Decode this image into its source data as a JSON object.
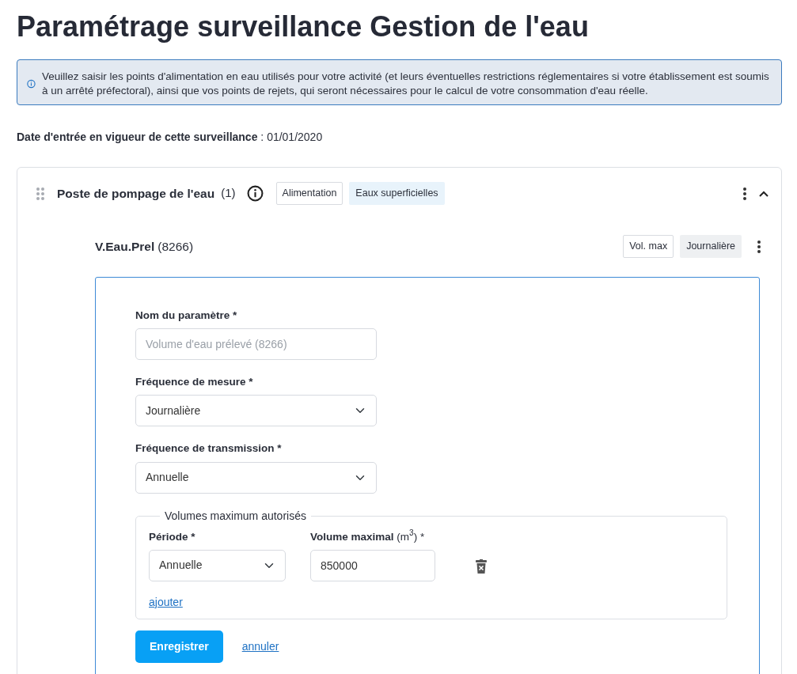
{
  "page": {
    "title": "Paramétrage surveillance Gestion de l'eau"
  },
  "info_alert": {
    "text": "Veuillez saisir les points d'alimentation en eau utilisés pour votre activité (et leurs éventuelles restrictions réglementaires si votre établissement est soumis à un arrêté préfectoral), ainsi que vos points de rejets, qui seront nécessaires pour le calcul de votre consommation d'eau réelle."
  },
  "effective_date": {
    "label": "Date d'entrée en vigueur de cette surveillance",
    "separator": " : ",
    "value": "01/01/2020"
  },
  "point": {
    "name": "Poste de pompage de l'eau",
    "count": "(1)",
    "expanded": true,
    "tags": [
      {
        "label": "Alimentation",
        "kind": "outline"
      },
      {
        "label": "Eaux superficielles",
        "kind": "tinted"
      }
    ],
    "parameter": {
      "code": "V.Eau.Prel",
      "number": "(8266)",
      "tags": [
        {
          "label": "Vol. max",
          "kind": "outline"
        },
        {
          "label": "Journalière",
          "kind": "grey"
        }
      ],
      "form": {
        "fields": [
          {
            "kind": "text",
            "label": "Nom du paramètre *",
            "placeholder": "Volume d'eau prélevé (8266)"
          },
          {
            "kind": "select",
            "label": "Fréquence de mesure *",
            "value": "Journalière"
          },
          {
            "kind": "select",
            "label": "Fréquence de transmission *",
            "value": "Annuelle"
          }
        ],
        "volumes": {
          "legend": "Volumes maximum autorisés",
          "period_label": "Période *",
          "volume_label": "**Volume maximal** (m$^{3}$) *",
          "rows": [
            {
              "period": "Annuelle",
              "volume": "850000"
            }
          ],
          "add_link": "ajouter"
        },
        "save_button": "Enregistrer",
        "cancel_link": "annuler"
      }
    }
  }
}
